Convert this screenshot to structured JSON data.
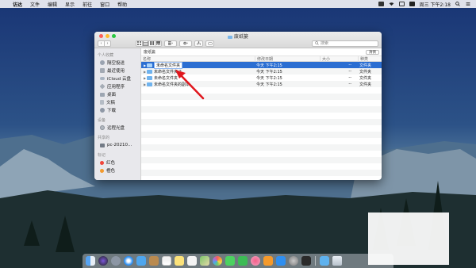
{
  "menubar": {
    "items": [
      "访达",
      "文件",
      "编辑",
      "显示",
      "前往",
      "窗口",
      "帮助"
    ],
    "clock": "周三 下午2:18"
  },
  "window": {
    "title": "废纸篓",
    "search_placeholder": "搜索",
    "path_label": "废纸篓",
    "return_button": "清倒"
  },
  "sidebar": {
    "sections": [
      {
        "header": "个人收藏",
        "items": [
          {
            "label": "隔空投送",
            "icon": "airdrop-icon"
          },
          {
            "label": "最近使用",
            "icon": "recent-icon"
          },
          {
            "label": "iCloud 云盘",
            "icon": "icloud-icon"
          },
          {
            "label": "应用程序",
            "icon": "applications-icon"
          },
          {
            "label": "桌面",
            "icon": "desktop-icon"
          },
          {
            "label": "文稿",
            "icon": "documents-icon"
          },
          {
            "label": "下载",
            "icon": "downloads-icon"
          }
        ]
      },
      {
        "header": "设备",
        "items": [
          {
            "label": "远程光盘",
            "icon": "disc-icon"
          }
        ]
      },
      {
        "header": "共享的",
        "items": [
          {
            "label": "pc-20210...",
            "icon": "computer-icon"
          }
        ]
      },
      {
        "header": "标记",
        "items": [
          {
            "label": "红色",
            "icon": "tag-red-icon",
            "color": "#f0453a"
          },
          {
            "label": "橙色",
            "icon": "tag-orange-icon",
            "color": "#f39a2d"
          }
        ]
      }
    ]
  },
  "file_list": {
    "columns": [
      "名称",
      "修改日期",
      "大小",
      "种类"
    ],
    "rows": [
      {
        "name": "未命名文件夹",
        "date": "今天 下午2:15",
        "size": "--",
        "kind": "文件夹",
        "selected": true,
        "renaming": true
      },
      {
        "name": "未命名文件夹 2",
        "date": "今天 下午2:15",
        "size": "--",
        "kind": "文件夹",
        "selected": false
      },
      {
        "name": "未命名文件夹",
        "date": "今天 下午2:15",
        "size": "--",
        "kind": "文件夹",
        "selected": false
      },
      {
        "name": "未命名文件夹的副本",
        "date": "今天 下午2:15",
        "size": "--",
        "kind": "文件夹",
        "selected": false
      }
    ]
  },
  "colors": {
    "selection": "#2b6ed2",
    "folder": "#6fb3ee",
    "annotation_arrow": "#e0161d"
  },
  "dock": {
    "icons": [
      "finder-icon",
      "siri-icon",
      "launchpad-icon",
      "safari-icon",
      "mail-icon",
      "contacts-icon",
      "calendar-icon",
      "notes-icon",
      "reminders-icon",
      "maps-icon",
      "photos-icon",
      "messages-icon",
      "facetime-icon",
      "itunes-icon",
      "books-icon",
      "appstore-icon",
      "settings-icon",
      "unknown-app-icon",
      "downloads-stack-icon",
      "trash-icon"
    ]
  }
}
